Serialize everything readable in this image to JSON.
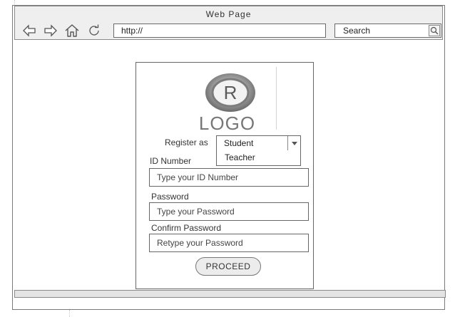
{
  "window": {
    "title": "Web Page",
    "url": "http://",
    "search_label": "Search"
  },
  "icons": {
    "back": "back-arrow-icon",
    "forward": "forward-arrow-icon",
    "home": "home-icon",
    "refresh": "refresh-icon",
    "search": "search-icon",
    "dropdown": "chevron-down-icon"
  },
  "form": {
    "logo_text": "LOGO",
    "register_label": "Register as",
    "role_selected": "Student",
    "role_options": [
      "Teacher"
    ],
    "id_label": "ID Number",
    "id_placeholder": "Type your ID Number",
    "password_label": "Password",
    "password_placeholder": "Type your Password",
    "confirm_label": "Confirm Password",
    "confirm_placeholder": "Retype your Password",
    "proceed_label": "PROCEED"
  }
}
